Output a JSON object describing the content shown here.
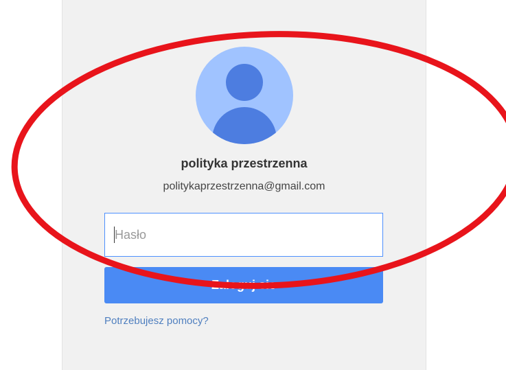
{
  "account": {
    "display_name": "polityka przestrzenna",
    "email": "politykaprzestrzenna@gmail.com"
  },
  "form": {
    "password_placeholder": "Hasło",
    "password_value": "",
    "signin_label": "Zaloguj sie",
    "help_link": "Potrzebujesz pomocy?"
  },
  "colors": {
    "card_background": "#f1f1f1",
    "avatar_background": "#a0c3ff",
    "avatar_figure": "#4d7de0",
    "button": "#4a8af4",
    "input_border": "#4d90fe",
    "link": "#4f7fbf",
    "annotation_ring": "#e8141b"
  },
  "icons": {
    "avatar": "person-silhouette-icon"
  }
}
